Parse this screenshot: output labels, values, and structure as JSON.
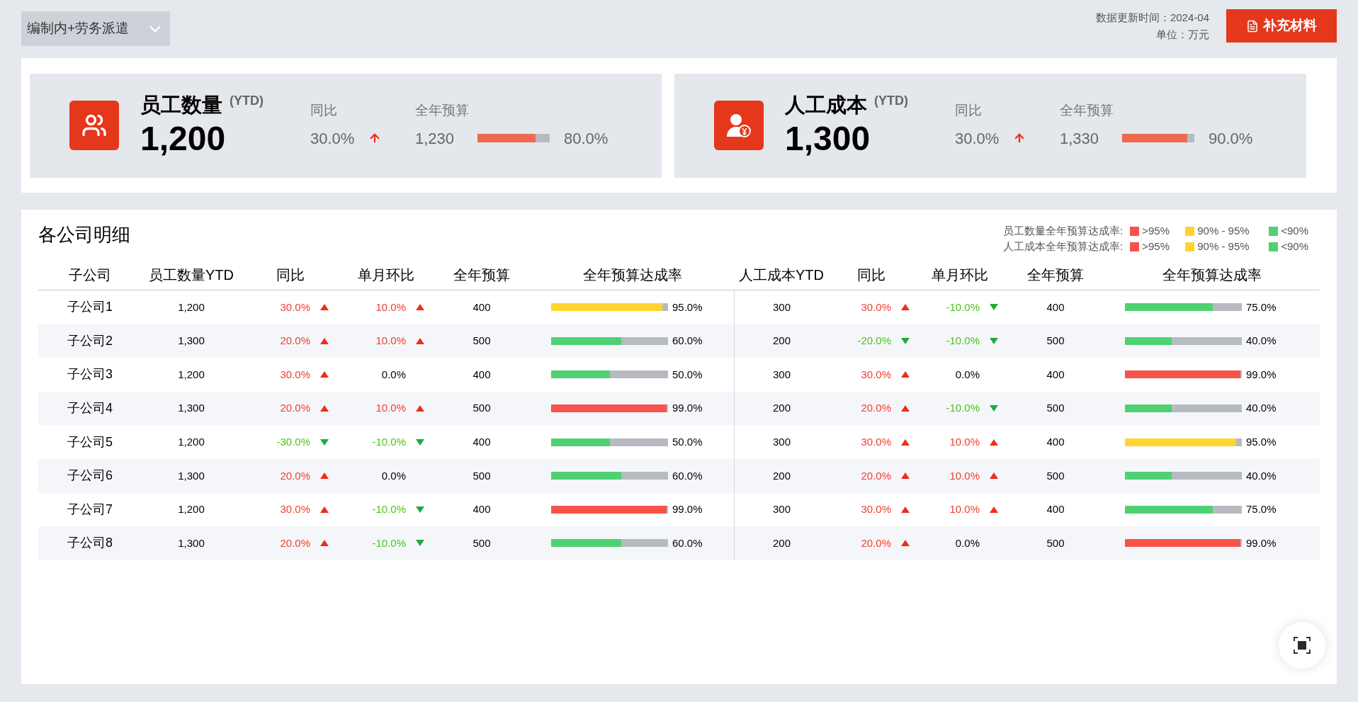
{
  "filter": {
    "label": "编制内+劳务派遣"
  },
  "meta": {
    "update_time": "数据更新时间：2024-04",
    "unit": "单位：万元"
  },
  "supplement_button": {
    "label": "补充材料"
  },
  "kpis": [
    {
      "kind": "people",
      "title": "员工数量",
      "suffix": "(YTD)",
      "value": "1,200",
      "yoy_label": "同比",
      "yoy": "30.0%",
      "trend": {
        "kind": "up"
      },
      "budget_label": "全年预算",
      "budget": "1,230",
      "level": 0.8,
      "rate": "80.0%"
    },
    {
      "kind": "cost",
      "title": "人工成本",
      "suffix": "(YTD)",
      "value": "1,300",
      "yoy_label": "同比",
      "yoy": "30.0%",
      "trend": {
        "kind": "up"
      },
      "budget_label": "全年预算",
      "budget": "1,330",
      "level": 0.9,
      "rate": "90.0%"
    }
  ],
  "detail": {
    "title": "各公司明细",
    "legend": [
      {
        "label": "员工数量全年预算达成率:",
        "items": [
          {
            "label": ">95%",
            "color": "#f8534a"
          },
          {
            "label": "90% - 95%",
            "color": "#ffd42e"
          },
          {
            "label": "<90%",
            "color": "#4fd173"
          }
        ]
      },
      {
        "label": "人工成本全年预算达成率:",
        "items": [
          {
            "label": ">95%",
            "color": "#f8534a"
          },
          {
            "label": "90% - 95%",
            "color": "#ffd42e"
          },
          {
            "label": "<90%",
            "color": "#4fd173"
          }
        ]
      }
    ],
    "columns": [
      "子公司",
      "员工数量YTD",
      "同比",
      "单月环比",
      "全年预算",
      "全年预算达成率",
      "人工成本YTD",
      "同比",
      "单月环比",
      "全年预算",
      "全年预算达成率"
    ],
    "rows": [
      {
        "cells": [
          {
            "kind": "name",
            "text": "子公司1"
          },
          {
            "kind": "number",
            "text": "1,200"
          },
          {
            "kind": "up",
            "text": "30.0%"
          },
          {
            "kind": "up",
            "text": "10.0%"
          },
          {
            "kind": "number",
            "text": "400"
          },
          {
            "kind": "rate",
            "level": 0.95,
            "color": "#ffd42e",
            "text": "95.0%"
          },
          {
            "kind": "number",
            "text": "300"
          },
          {
            "kind": "up",
            "text": "30.0%"
          },
          {
            "kind": "down",
            "text": "-10.0%"
          },
          {
            "kind": "number",
            "text": "400"
          },
          {
            "kind": "rate",
            "level": 0.75,
            "color": "#4fd173",
            "text": "75.0%"
          }
        ]
      },
      {
        "cells": [
          {
            "kind": "name",
            "text": "子公司2"
          },
          {
            "kind": "number",
            "text": "1,300"
          },
          {
            "kind": "up",
            "text": "20.0%"
          },
          {
            "kind": "up",
            "text": "10.0%"
          },
          {
            "kind": "number",
            "text": "500"
          },
          {
            "kind": "rate",
            "level": 0.6,
            "color": "#4fd173",
            "text": "60.0%"
          },
          {
            "kind": "number",
            "text": "200"
          },
          {
            "kind": "down",
            "text": "-20.0%"
          },
          {
            "kind": "down",
            "text": "-10.0%"
          },
          {
            "kind": "number",
            "text": "500"
          },
          {
            "kind": "rate",
            "level": 0.4,
            "color": "#4fd173",
            "text": "40.0%"
          }
        ]
      },
      {
        "cells": [
          {
            "kind": "name",
            "text": "子公司3"
          },
          {
            "kind": "number",
            "text": "1,200"
          },
          {
            "kind": "up",
            "text": "30.0%"
          },
          {
            "kind": "flat",
            "text": "0.0%"
          },
          {
            "kind": "number",
            "text": "400"
          },
          {
            "kind": "rate",
            "level": 0.5,
            "color": "#4fd173",
            "text": "50.0%"
          },
          {
            "kind": "number",
            "text": "300"
          },
          {
            "kind": "up",
            "text": "30.0%"
          },
          {
            "kind": "flat",
            "text": "0.0%"
          },
          {
            "kind": "number",
            "text": "400"
          },
          {
            "kind": "rate",
            "level": 0.99,
            "color": "#f8534a",
            "text": "99.0%"
          }
        ]
      },
      {
        "cells": [
          {
            "kind": "name",
            "text": "子公司4"
          },
          {
            "kind": "number",
            "text": "1,300"
          },
          {
            "kind": "up",
            "text": "20.0%"
          },
          {
            "kind": "up",
            "text": "10.0%"
          },
          {
            "kind": "number",
            "text": "500"
          },
          {
            "kind": "rate",
            "level": 0.99,
            "color": "#f8534a",
            "text": "99.0%"
          },
          {
            "kind": "number",
            "text": "200"
          },
          {
            "kind": "up",
            "text": "20.0%"
          },
          {
            "kind": "down",
            "text": "-10.0%"
          },
          {
            "kind": "number",
            "text": "500"
          },
          {
            "kind": "rate",
            "level": 0.4,
            "color": "#4fd173",
            "text": "40.0%"
          }
        ]
      },
      {
        "cells": [
          {
            "kind": "name",
            "text": "子公司5"
          },
          {
            "kind": "number",
            "text": "1,200"
          },
          {
            "kind": "down",
            "text": "-30.0%"
          },
          {
            "kind": "down",
            "text": "-10.0%"
          },
          {
            "kind": "number",
            "text": "400"
          },
          {
            "kind": "rate",
            "level": 0.5,
            "color": "#4fd173",
            "text": "50.0%"
          },
          {
            "kind": "number",
            "text": "300"
          },
          {
            "kind": "up",
            "text": "30.0%"
          },
          {
            "kind": "up",
            "text": "10.0%"
          },
          {
            "kind": "number",
            "text": "400"
          },
          {
            "kind": "rate",
            "level": 0.95,
            "color": "#ffd42e",
            "text": "95.0%"
          }
        ]
      },
      {
        "cells": [
          {
            "kind": "name",
            "text": "子公司6"
          },
          {
            "kind": "number",
            "text": "1,300"
          },
          {
            "kind": "up",
            "text": "20.0%"
          },
          {
            "kind": "flat",
            "text": "0.0%"
          },
          {
            "kind": "number",
            "text": "500"
          },
          {
            "kind": "rate",
            "level": 0.6,
            "color": "#4fd173",
            "text": "60.0%"
          },
          {
            "kind": "number",
            "text": "200"
          },
          {
            "kind": "up",
            "text": "20.0%"
          },
          {
            "kind": "up",
            "text": "10.0%"
          },
          {
            "kind": "number",
            "text": "500"
          },
          {
            "kind": "rate",
            "level": 0.4,
            "color": "#4fd173",
            "text": "40.0%"
          }
        ]
      },
      {
        "cells": [
          {
            "kind": "name",
            "text": "子公司7"
          },
          {
            "kind": "number",
            "text": "1,200"
          },
          {
            "kind": "up",
            "text": "30.0%"
          },
          {
            "kind": "down",
            "text": "-10.0%"
          },
          {
            "kind": "number",
            "text": "400"
          },
          {
            "kind": "rate",
            "level": 0.99,
            "color": "#f8534a",
            "text": "99.0%"
          },
          {
            "kind": "number",
            "text": "300"
          },
          {
            "kind": "up",
            "text": "30.0%"
          },
          {
            "kind": "up",
            "text": "10.0%"
          },
          {
            "kind": "number",
            "text": "400"
          },
          {
            "kind": "rate",
            "level": 0.75,
            "color": "#4fd173",
            "text": "75.0%"
          }
        ]
      },
      {
        "cells": [
          {
            "kind": "name",
            "text": "子公司8"
          },
          {
            "kind": "number",
            "text": "1,300"
          },
          {
            "kind": "up",
            "text": "20.0%"
          },
          {
            "kind": "down",
            "text": "-10.0%"
          },
          {
            "kind": "number",
            "text": "500"
          },
          {
            "kind": "rate",
            "level": 0.6,
            "color": "#4fd173",
            "text": "60.0%"
          },
          {
            "kind": "number",
            "text": "200"
          },
          {
            "kind": "up",
            "text": "20.0%"
          },
          {
            "kind": "flat",
            "text": "0.0%"
          },
          {
            "kind": "number",
            "text": "500"
          },
          {
            "kind": "rate",
            "level": 0.99,
            "color": "#f8534a",
            "text": "99.0%"
          }
        ]
      }
    ]
  }
}
